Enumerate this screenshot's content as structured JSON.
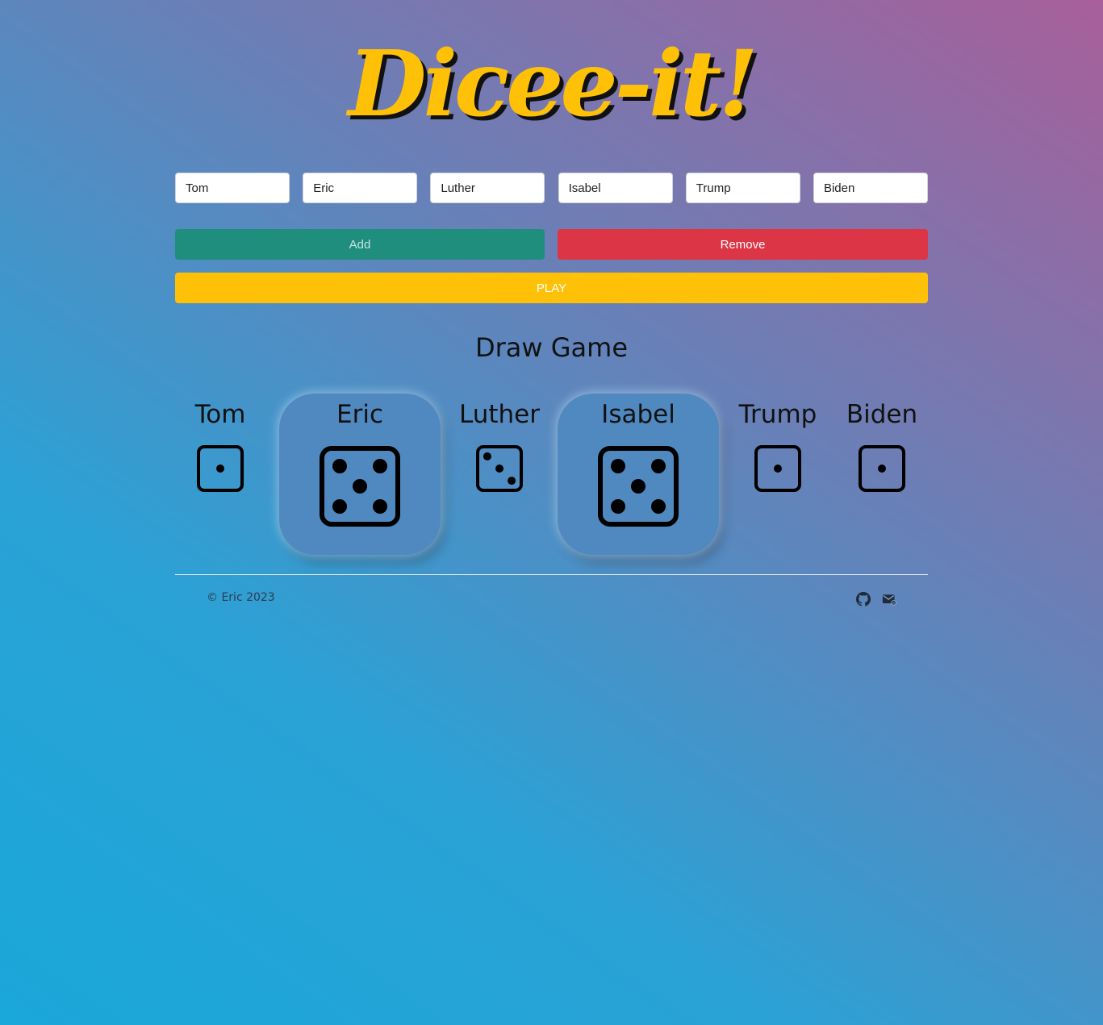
{
  "app": {
    "title": "Dicee-it!"
  },
  "players": [
    {
      "name": "Tom"
    },
    {
      "name": "Eric"
    },
    {
      "name": "Luther"
    },
    {
      "name": "Isabel"
    },
    {
      "name": "Trump"
    },
    {
      "name": "Biden"
    }
  ],
  "controls": {
    "add_label": "Add",
    "remove_label": "Remove",
    "play_label": "PLAY"
  },
  "result": {
    "text": "Draw Game"
  },
  "dice": [
    {
      "player": "Tom",
      "value": 1,
      "winner": false,
      "icon": "dice-1-icon"
    },
    {
      "player": "Eric",
      "value": 5,
      "winner": true,
      "icon": "dice-5-icon"
    },
    {
      "player": "Luther",
      "value": 3,
      "winner": false,
      "icon": "dice-3-icon"
    },
    {
      "player": "Isabel",
      "value": 5,
      "winner": true,
      "icon": "dice-5-icon"
    },
    {
      "player": "Trump",
      "value": 1,
      "winner": false,
      "icon": "dice-1-icon"
    },
    {
      "player": "Biden",
      "value": 1,
      "winner": false,
      "icon": "dice-1-icon"
    }
  ],
  "footer": {
    "copyright": "© Eric 2023",
    "icons": [
      "github-icon",
      "mail-icon"
    ]
  },
  "colors": {
    "title": "#fec107",
    "add_button": "#1f8e7d",
    "remove_button": "#dc3545",
    "play_button": "#fec107",
    "winner_card": "#5089c0"
  }
}
